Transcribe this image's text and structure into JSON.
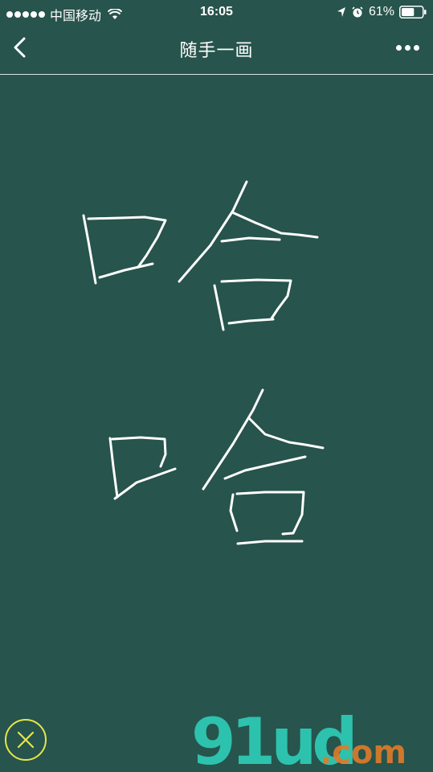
{
  "status_bar": {
    "carrier": "中国移动",
    "time": "16:05",
    "battery_percent": "61%",
    "battery_level": 0.61,
    "icons": [
      "signal-dots",
      "wifi-icon",
      "location-arrow-icon",
      "alarm-icon",
      "battery-icon"
    ]
  },
  "nav": {
    "title": "随手一画",
    "back_icon": "chevron-left-icon",
    "more_icon": "more-dots-icon"
  },
  "canvas": {
    "background": "#27544c",
    "stroke_color": "#ffffff",
    "drawn_characters": [
      "哈",
      "哈"
    ]
  },
  "close_button": {
    "icon": "close-x-icon",
    "color": "#e6e64a"
  },
  "watermark": {
    "logo": "91ud",
    "suffix": ".com"
  }
}
